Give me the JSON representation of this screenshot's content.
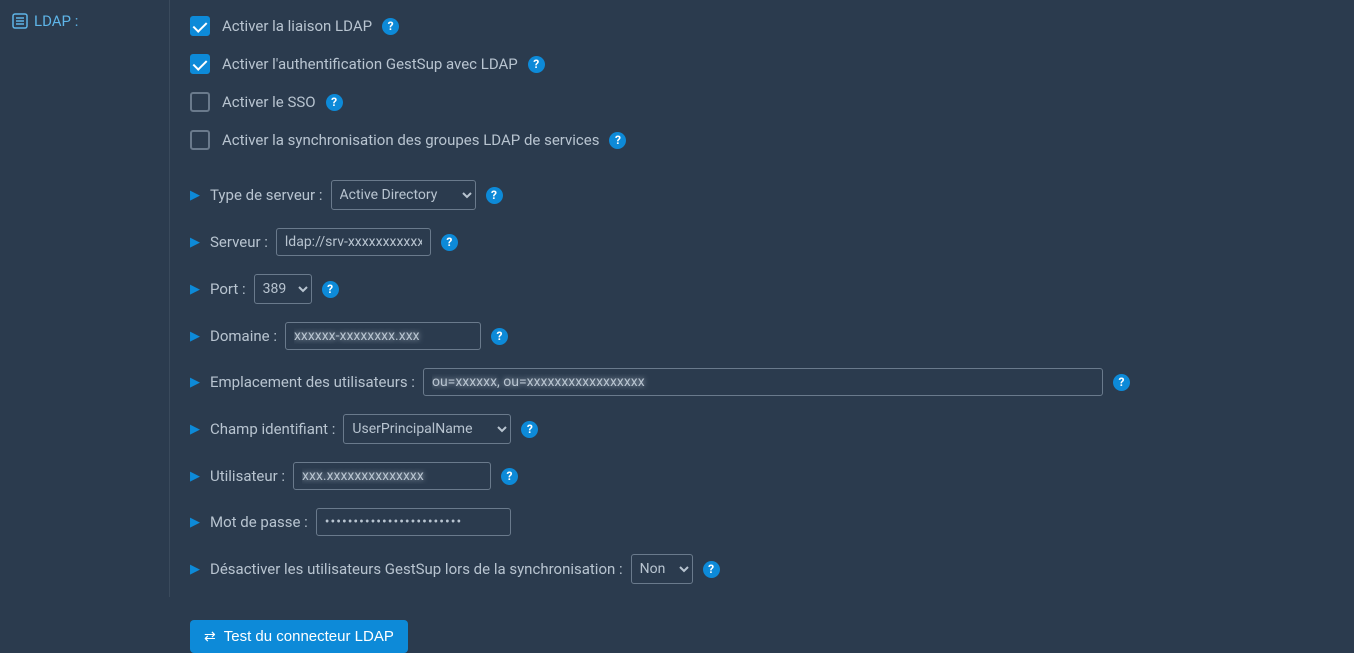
{
  "sidebar": {
    "title": "LDAP :"
  },
  "checkboxes": {
    "enable_ldap": {
      "label": "Activer la liaison LDAP",
      "checked": true
    },
    "enable_auth": {
      "label": "Activer l'authentification GestSup avec LDAP",
      "checked": true
    },
    "enable_sso": {
      "label": "Activer le SSO",
      "checked": false
    },
    "enable_sync_groups": {
      "label": "Activer la synchronisation des groupes LDAP de services",
      "checked": false
    }
  },
  "fields": {
    "server_type": {
      "label": "Type de serveur :",
      "value": "Active Directory",
      "options": [
        "Active Directory"
      ]
    },
    "server": {
      "label": "Serveur :",
      "value": "ldap://srv-xxxxxxxxxxx"
    },
    "port": {
      "label": "Port :",
      "value": "389",
      "options": [
        "389"
      ]
    },
    "domain": {
      "label": "Domaine :",
      "value": "xxxxxx-xxxxxxxx.xxx"
    },
    "user_location": {
      "label": "Emplacement des utilisateurs :",
      "value": "ou=xxxxxx, ou=xxxxxxxxxxxxxxxxx"
    },
    "ident_field": {
      "label": "Champ identifiant :",
      "value": "UserPrincipalName",
      "options": [
        "UserPrincipalName"
      ]
    },
    "user": {
      "label": "Utilisateur :",
      "value": "xxx.xxxxxxxxxxxxxx"
    },
    "password": {
      "label": "Mot de passe :",
      "value": "••••••••••••••••••••••••"
    },
    "disable_users": {
      "label": "Désactiver les utilisateurs GestSup lors de la synchronisation :",
      "value": "Non",
      "options": [
        "Non"
      ]
    }
  },
  "button": {
    "test": "Test du connecteur LDAP"
  },
  "help": "?"
}
